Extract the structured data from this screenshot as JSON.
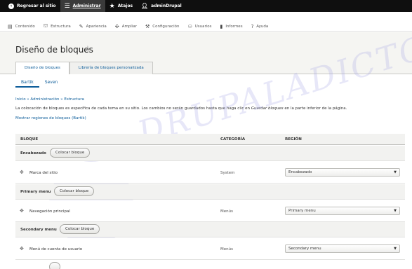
{
  "toolbar": {
    "back_label": "Regresar al sitio",
    "admin_label": "Administrar",
    "shortcuts_label": "Atajos",
    "user_label": "adminDrupal"
  },
  "tray": {
    "items": [
      {
        "label": "Contenido",
        "icon": "document-icon"
      },
      {
        "label": "Estructura",
        "icon": "structure-icon"
      },
      {
        "label": "Apariencia",
        "icon": "brush-icon"
      },
      {
        "label": "Ampliar",
        "icon": "puzzle-icon"
      },
      {
        "label": "Configuración",
        "icon": "wrench-icon"
      },
      {
        "label": "Usuarios",
        "icon": "users-icon"
      },
      {
        "label": "Informes",
        "icon": "bar-chart-icon"
      },
      {
        "label": "Ayuda",
        "icon": "help-icon"
      }
    ]
  },
  "page": {
    "title": "Diseño de bloques",
    "primary_tabs": [
      "Diseño de bloques",
      "Librería de bloques personalizada"
    ],
    "secondary_tabs": [
      "Bartik",
      "Seven"
    ],
    "breadcrumb": "Inicio » Administración » Estructura",
    "help_before": "La colocación de bloques es específica de cada tema en su sitio. Los cambios no serán guardados hasta que haga clic en ",
    "help_em": "Guardar bloques",
    "help_after": " en la parte inferior de la página.",
    "regions_link": "Mostrar regiones de bloques (Bartik)"
  },
  "table": {
    "headers": {
      "block": "BLOQUE",
      "category": "CATEGORÍA",
      "region": "REGIÓN"
    },
    "place_button": "Colocar bloque",
    "regions": [
      {
        "name": "Encabezado",
        "block": "Marca del sitio",
        "category": "System",
        "region": "Encabezado"
      },
      {
        "name": "Primary menu",
        "block": "Navegación principal",
        "category": "Menús",
        "region": "Primary menu"
      },
      {
        "name": "Secondary menu",
        "block": "Menú de cuenta de usuario",
        "category": "Menús",
        "region": "Secondary menu"
      }
    ]
  },
  "watermark": "DRUPALADICTO",
  "colors": {
    "toolbar": "#0f0f0f",
    "link": "#0b5c99",
    "header_bg": "#f5f5f2"
  }
}
